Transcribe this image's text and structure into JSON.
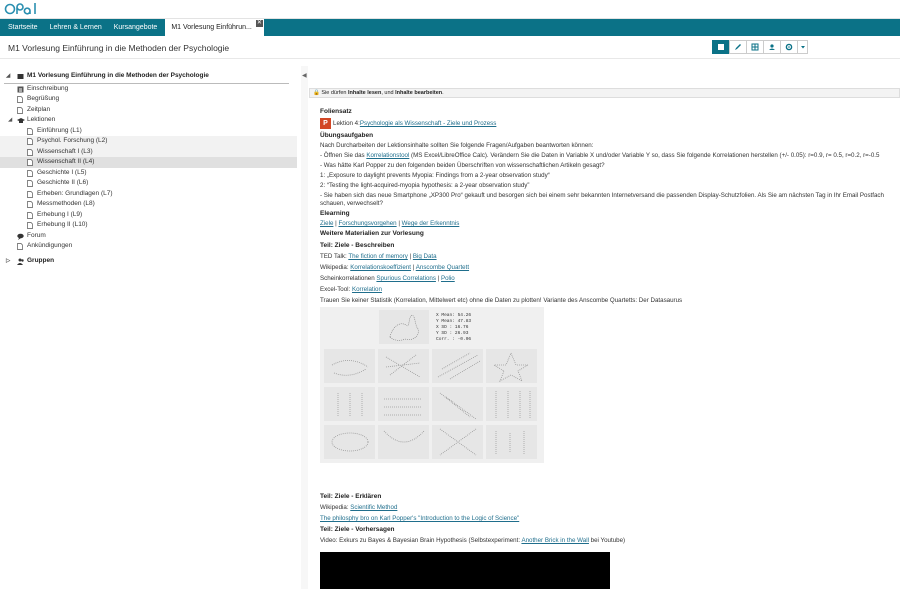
{
  "app": {
    "logo_text": "OPAL",
    "accent": "#0b7287"
  },
  "nav": {
    "tabs": [
      {
        "label": "Startseite"
      },
      {
        "label": "Lehren & Lernen"
      },
      {
        "label": "Kursangebote"
      },
      {
        "label": "M1 Vorlesung Einführun..."
      }
    ]
  },
  "course": {
    "title": "M1 Vorlesung Einführung in die Methoden der Psychologie"
  },
  "toolbar": {
    "icons": [
      "book-icon",
      "pencil-icon",
      "table-icon",
      "users-icon",
      "gear-icon",
      "caret-down-icon"
    ]
  },
  "tree": {
    "root": "M1 Vorlesung Einführung in die Methoden der Psychologie",
    "top": [
      {
        "label": "Einschreibung"
      },
      {
        "label": "Begrüßung"
      },
      {
        "label": "Zeitplan"
      }
    ],
    "lektionen": "Lektionen",
    "lektionen_items": [
      {
        "label": "Einführung (L1)"
      },
      {
        "label": "Psychol. Forschung (L2)"
      },
      {
        "label": "Wissenschaft I (L3)"
      },
      {
        "label": "Wissenschaft II (L4)"
      },
      {
        "label": "Geschichte I (L5)"
      },
      {
        "label": "Geschichte II (L6)"
      },
      {
        "label": "Erheben: Grundlagen (L7)"
      },
      {
        "label": "Messmethoden (L8)"
      },
      {
        "label": "Erhebung I (L9)"
      },
      {
        "label": "Erhebung II (L10)"
      }
    ],
    "forum": "Forum",
    "ankuendigungen": "Ankündigungen",
    "gruppen": "Gruppen"
  },
  "notice": {
    "pre": "Sie dürfen ",
    "b1": "Inhalte lesen",
    "mid": ", und ",
    "b2": "Inhalte bearbeiten",
    "post": "."
  },
  "content": {
    "foliensatz": "Foliensatz",
    "lektion_prefix": "Lektion 4: ",
    "lektion_link": "Psychologie als Wissenschaft - Ziele und Prozess",
    "uebung": "Übungsaufgaben",
    "intro": "Nach Durcharbeiten der Lektionsinhalte sollten Sie folgende Fragen/Aufgaben beantworten können:",
    "task1_pre": "- Öffnen Sie das ",
    "task1_link": "Korrelationstool",
    "task1_post": " (MS Excel/LibreOffice Calc). Verändern Sie die Daten in Variable X und/oder Variable Y so, dass Sie folgende Korrelationen herstellen (+/- 0.05): r=0.9, r= 0.5, r=0.2, r=-0.5",
    "task2": "-  Was hätte Karl Popper zu den folgenden beiden Überschriften von wissenschaftlichen Artikeln gesagt?",
    "q1": "1: „Exposure to daylight prevents Myopia: Findings from a 2-year observation study“",
    "q2": "2: “Testing the light-acquired-myopia hypothesis: a 2-year observation study”",
    "task3": "- Sie haben sich das neue Smartphone „XP300 Pro“ gekauft und besorgen sich bei einem sehr bekannten Internetversand die passenden Display-Schutzfolien. Als Sie am nächsten Tag in Ihr Email Postfach schauen, verwechselt?",
    "elearning": "Elearning",
    "el_links": [
      "Ziele",
      "Forschungsvorgehen",
      "Wege der Erkenntnis"
    ],
    "weitere": "Weitere Materialien zur Vorlesung",
    "teil1": "Teil: Ziele - Beschreiben",
    "ted_pre": "TED Talk: ",
    "ted_links": [
      "The fiction of memory",
      "Big Data"
    ],
    "wiki1_pre": "Wikipedia: ",
    "wiki1_links": [
      "Korrelationskoeffizient",
      "Anscombe Quartett"
    ],
    "schein_pre": "Scheinkorrelationen ",
    "schein_links": [
      "Spurious Correlations",
      "Polio"
    ],
    "excel_pre": "Excel-Tool: ",
    "excel_link": "Korrelation",
    "trauen": "Trauen Sie keiner Statistik (Korrelation, Mittelwert etc) ohne die Daten zu plotten! Variante des Anscombe Quartetts: Der Datasaurus",
    "datasaurus_stats": [
      "X Mean: 54.26",
      "Y Mean: 47.83",
      "X SD  : 16.76",
      "Y SD  : 26.93",
      "Corr. : -0.06"
    ],
    "teil2": "Teil: Ziele - Erklären",
    "wiki2_pre": "Wikipedia: ",
    "wiki2_link": "Scientific Method",
    "philo_link": "The philosphy bro on Karl Popper's \"Introduction to the Logic of Science\"",
    "teil3": "Teil: Ziele - Vorhersagen",
    "video_pre": "Video: Exkurs zu Bayes & Bayesian Brain Hypothesis (Selbstexperiment: ",
    "video_link": "Another Brick in the Wall",
    "video_post": " bei Youtube)"
  }
}
